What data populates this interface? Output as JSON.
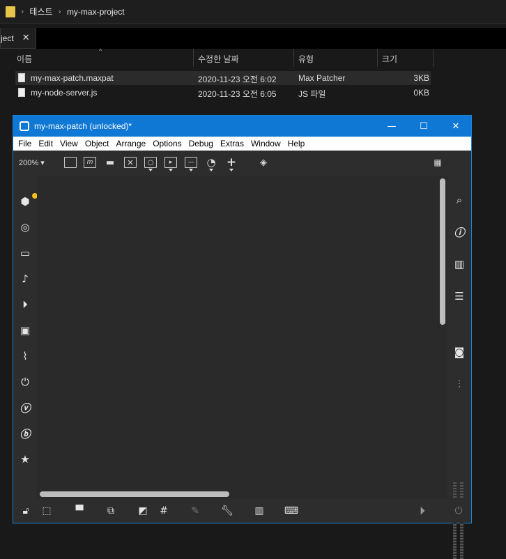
{
  "explorer": {
    "breadcrumb": [
      "테스트",
      "my-max-project"
    ],
    "tab_label": "ject",
    "columns": [
      "이름",
      "수정한 날짜",
      "유형",
      "크기"
    ],
    "files": [
      {
        "name": "my-max-patch.maxpat",
        "date": "2020-11-23 오전 6:02",
        "type": "Max Patcher",
        "size": "3KB",
        "selected": true
      },
      {
        "name": "my-node-server.js",
        "date": "2020-11-23 오전 6:05",
        "type": "JS 파일",
        "size": "0KB",
        "selected": false
      }
    ]
  },
  "maxwindow": {
    "title": "my-max-patch (unlocked)*",
    "controls": {
      "minimize": "—",
      "maximize": "☐",
      "close": "✕"
    },
    "menu": [
      "File",
      "Edit",
      "View",
      "Object",
      "Arrange",
      "Options",
      "Debug",
      "Extras",
      "Window",
      "Help"
    ],
    "zoom": "200% ▾",
    "toolbar_icons": [
      "object-box-icon",
      "message-box-icon",
      "comment-icon",
      "toggle-icon",
      "button-icon",
      "slider-icon",
      "number-box-icon",
      "dial-icon",
      "add-icon",
      "paint-bucket-icon",
      "grid-icon"
    ],
    "left_icons": [
      "package-icon",
      "target-icon",
      "monitor-icon",
      "note-icon",
      "media-icon",
      "image-icon",
      "paperclip-icon",
      "plug-icon",
      "vizzie-icon",
      "beap-icon",
      "star-icon"
    ],
    "right_icons": [
      "search-icon",
      "info-icon",
      "book-icon",
      "list-icon",
      "camera-icon",
      "mixer-icon"
    ],
    "bottom_icons": [
      "lock-icon",
      "presentation-icon",
      "present-icon",
      "layers-icon",
      "flip-icon",
      "grid-toggle-icon",
      "pin-icon",
      "wrench-icon",
      "keyboard-piano-icon",
      "keyboard-icon",
      "play-icon",
      "power-icon"
    ]
  }
}
